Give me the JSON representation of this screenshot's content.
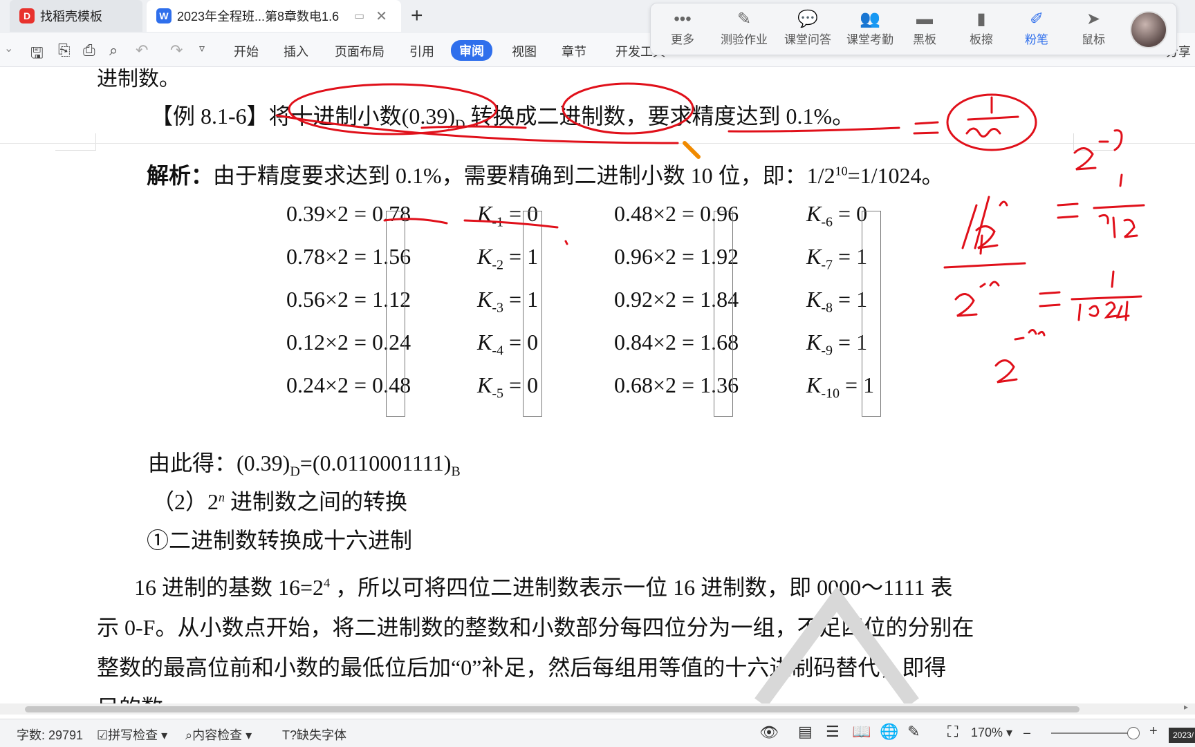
{
  "tabs": [
    {
      "label": "找稻壳模板",
      "icon": "docer-icon"
    },
    {
      "label": "2023年全程班...第8章数电1.6",
      "icon": "wps-writer-icon"
    }
  ],
  "menu": [
    "开始",
    "插入",
    "页面布局",
    "引用",
    "审阅",
    "视图",
    "章节",
    "开发工具"
  ],
  "float_toolbar": [
    "更多",
    "测验作业",
    "课堂问答",
    "课堂考勤",
    "黑板",
    "板擦",
    "粉笔",
    "鼠标"
  ],
  "toolbar_right": [
    "分享"
  ],
  "doc": {
    "line0": "进制数。",
    "example_label": "【例 8.1-6】",
    "example_text_a": "将十进制小数(0.39)",
    "example_sub_d": "D",
    "example_text_b": " 转换成二进制数，要求精度达到 0.1%。",
    "analysis_label": "解析：",
    "analysis_text_a": "由于精度要求达到 0.1%，需要精确到二进制小数 10 位，即：1/2",
    "analysis_sup": "10",
    "analysis_text_b": "=1/1024。",
    "calc_left": [
      "0.39×2 = 0.78",
      "0.78×2 = 1.56",
      "0.56×2 = 1.12",
      "0.12×2 = 0.24",
      "0.24×2 = 0.48"
    ],
    "k_left": [
      {
        "sub": "-1",
        "val": "0"
      },
      {
        "sub": "-2",
        "val": "1"
      },
      {
        "sub": "-3",
        "val": "1"
      },
      {
        "sub": "-4",
        "val": "0"
      },
      {
        "sub": "-5",
        "val": "0"
      }
    ],
    "calc_right": [
      "0.48×2 = 0.96",
      "0.96×2 = 1.92",
      "0.92×2 = 1.84",
      "0.84×2 = 1.68",
      "0.68×2 = 1.36"
    ],
    "k_right": [
      {
        "sub": "-6",
        "val": "0"
      },
      {
        "sub": "-7",
        "val": "1"
      },
      {
        "sub": "-8",
        "val": "1"
      },
      {
        "sub": "-9",
        "val": "1"
      },
      {
        "sub": "-10",
        "val": "1"
      }
    ],
    "k_letter": "K",
    "result_a": "由此得：(0.39)",
    "result_sub_d": "D",
    "result_b": "=(0.0110001111)",
    "result_sub_b": "B",
    "section2_a": "（2）2",
    "section2_sup": "n",
    "section2_b": " 进制数之间的转换",
    "section2_1": "①二进制数转换成十六进制",
    "para1_a": "16 进制的基数 16=2",
    "para1_sup": "4",
    "para1_b": " ，所以可将四位二进制数表示一位 16 进制数，即 0000～1111 表",
    "para2": "示 0-F。从小数点开始，将二进制数的整数和小数部分每四位分为一组，不足四位的分别在",
    "para3": "整数的最高位前和小数的最低位后加“0”补足，然后每组用等值的十六进制码替代，即得",
    "para4": "目的数"
  },
  "status": {
    "word_count": "字数: 29791",
    "spell_check": "拼写检查",
    "content_check": "内容检查",
    "missing_font": "缺失字体",
    "zoom": "170%",
    "corner": "2023/"
  },
  "colors": {
    "accent": "#2f6fec",
    "annotation_red": "#e0101a",
    "pen_orange": "#f08a00"
  }
}
